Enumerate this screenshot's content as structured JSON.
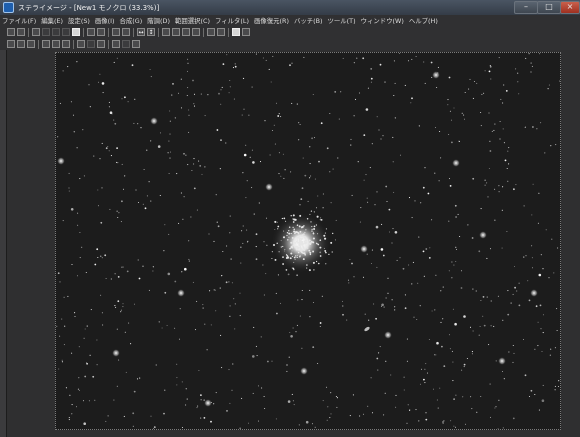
{
  "window": {
    "title": "ステライメージ - [New1 モノクロ (33.3%)]",
    "controls": {
      "minimize": "–",
      "maximize": "□",
      "close": "×"
    }
  },
  "menu": [
    "ファイル(F)",
    "編集(E)",
    "設定(S)",
    "画像(I)",
    "合成(G)",
    "階調(D)",
    "範囲選択(C)",
    "フィルタ(L)",
    "画像復元(R)",
    "バッチ(B)",
    "ツール(T)",
    "ウィンドウ(W)",
    "ヘルプ(H)"
  ],
  "toolbar1": {
    "icons": [
      "new-icon",
      "open-icon",
      "save-icon",
      "print-icon",
      "undo-icon",
      "redo-icon",
      "copy-icon",
      "paste-icon",
      "grid-icon",
      "crop-icon",
      "flip-h-icon",
      "flip-v-icon",
      "rotate-left-icon",
      "rotate-right-icon",
      "rotate-icon",
      "levels-icon",
      "curves-icon",
      "histogram-icon",
      "batch-icon",
      "compose-icon",
      "info-icon"
    ],
    "flip_h_glyph": "↔",
    "flip_v_glyph": "↕"
  },
  "toolbar2": {
    "icons": [
      "select-icon",
      "zoom-in-icon",
      "zoom-out-icon",
      "fit-icon",
      "rgb-icon",
      "gray-icon",
      "filter-icon",
      "mask-icon",
      "star-icon",
      "align-icon",
      "crosshair-icon",
      "measure-icon"
    ]
  },
  "image": {
    "subject": "star field with globular cluster",
    "background_color": "#1c1c1c"
  }
}
